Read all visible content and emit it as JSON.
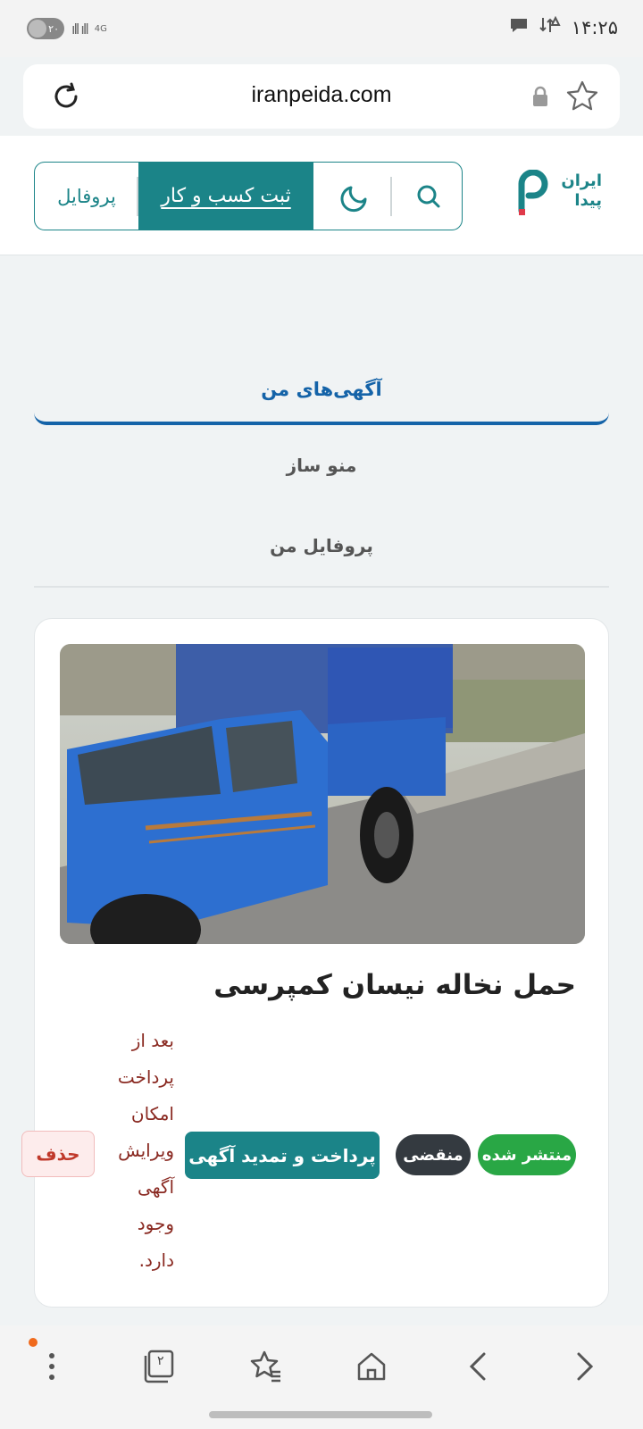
{
  "status_bar": {
    "battery_level": "۲۰",
    "network": "4G",
    "time": "۱۴:۲۵"
  },
  "browser": {
    "url": "iranpeida.com",
    "icons": [
      "reload-icon",
      "lock-icon",
      "bookmark-star-icon"
    ]
  },
  "header": {
    "logo_line1": "ایران",
    "logo_line2": "پیدا",
    "nav_profile": "پروفایل",
    "nav_register": "ثبت کسب و کار",
    "icons": [
      "moon-icon",
      "search-icon"
    ]
  },
  "tabs": {
    "active": "آگهی‌های من",
    "items": [
      "منو ساز",
      "پروفایل من"
    ]
  },
  "ad": {
    "title": "حمل نخاله نیسان کمپرسی",
    "notice": "بعد از پرداخت امکان ویرایش آگهی وجود دارد.",
    "status_published": "منتشر شده",
    "status_expired": "منقضی",
    "pay_button": "پرداخت و تمدید آگهی",
    "delete_button": "حذف"
  },
  "bottom_bar": {
    "tab_count": "۲",
    "icons": [
      "more-icon",
      "tabs-icon",
      "bookmarks-icon",
      "home-icon",
      "back-icon",
      "forward-icon"
    ]
  },
  "colors": {
    "brand": "#1b8488",
    "active_tab": "#1463a8",
    "published": "#29a745",
    "expired": "#343a40",
    "notice": "#8a2a22",
    "delete": "#c0392b"
  }
}
